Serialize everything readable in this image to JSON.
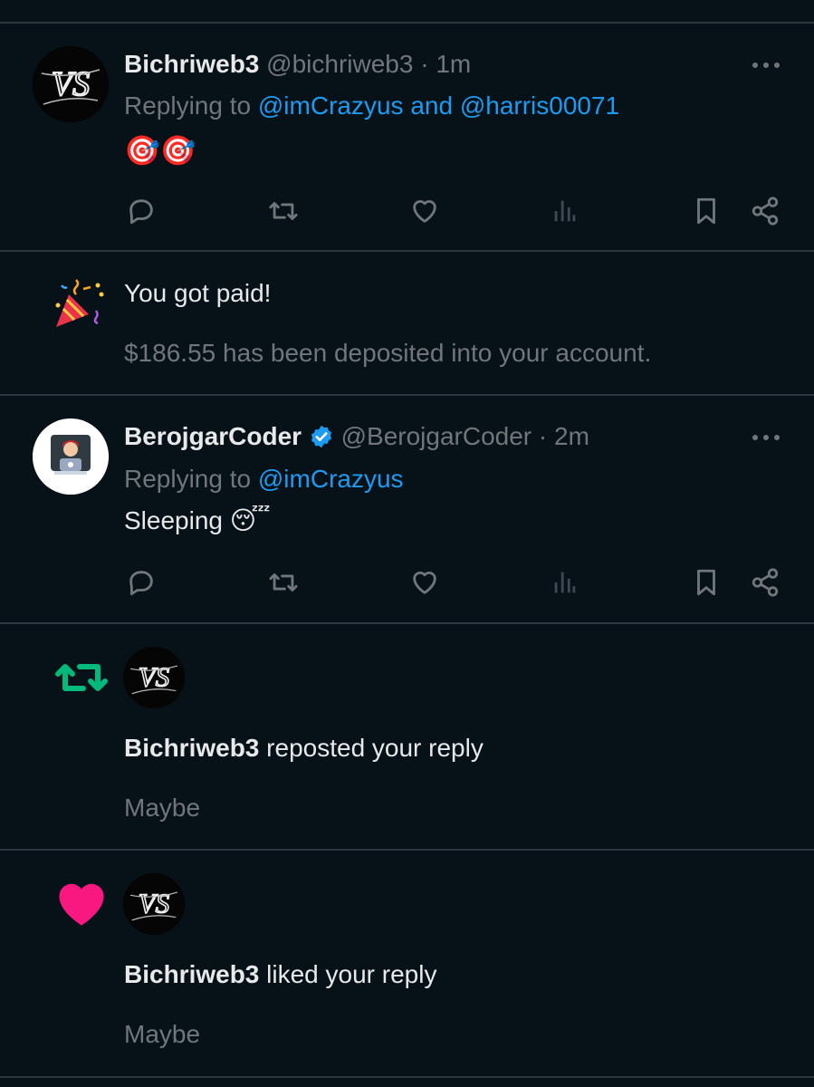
{
  "tweet1": {
    "display_name": "Bichriweb3",
    "handle": "@bichriweb3",
    "dot": "·",
    "time": "1m",
    "replying_prefix": "Replying to",
    "mention1": "@imCrazyus",
    "and": "and",
    "mention2": "@harris00071",
    "content": "🎯🎯",
    "avatar_text": "VS"
  },
  "paid": {
    "title": "You got paid!",
    "detail": "$186.55 has been deposited into your account.",
    "icon": "party-popper-icon"
  },
  "tweet2": {
    "display_name": "BerojgarCoder",
    "handle": "@BerojgarCoder",
    "dot": "·",
    "time": "2m",
    "replying_prefix": "Replying to",
    "mention1": "@imCrazyus",
    "content": "Sleeping",
    "emoji": "😴",
    "verified": true
  },
  "repost_notif": {
    "actor": "Bichriweb3",
    "text": "reposted your reply",
    "preview": "Maybe",
    "icon_color": "#00ba7c"
  },
  "like_notif": {
    "actor": "Bichriweb3",
    "text": "liked your reply",
    "preview": "Maybe",
    "icon_color": "#f91880"
  },
  "colors": {
    "background": "#061118",
    "separator": "#2b3640",
    "muted": "#71767b",
    "link": "#1d9bf0",
    "text": "#e7e9ea"
  }
}
